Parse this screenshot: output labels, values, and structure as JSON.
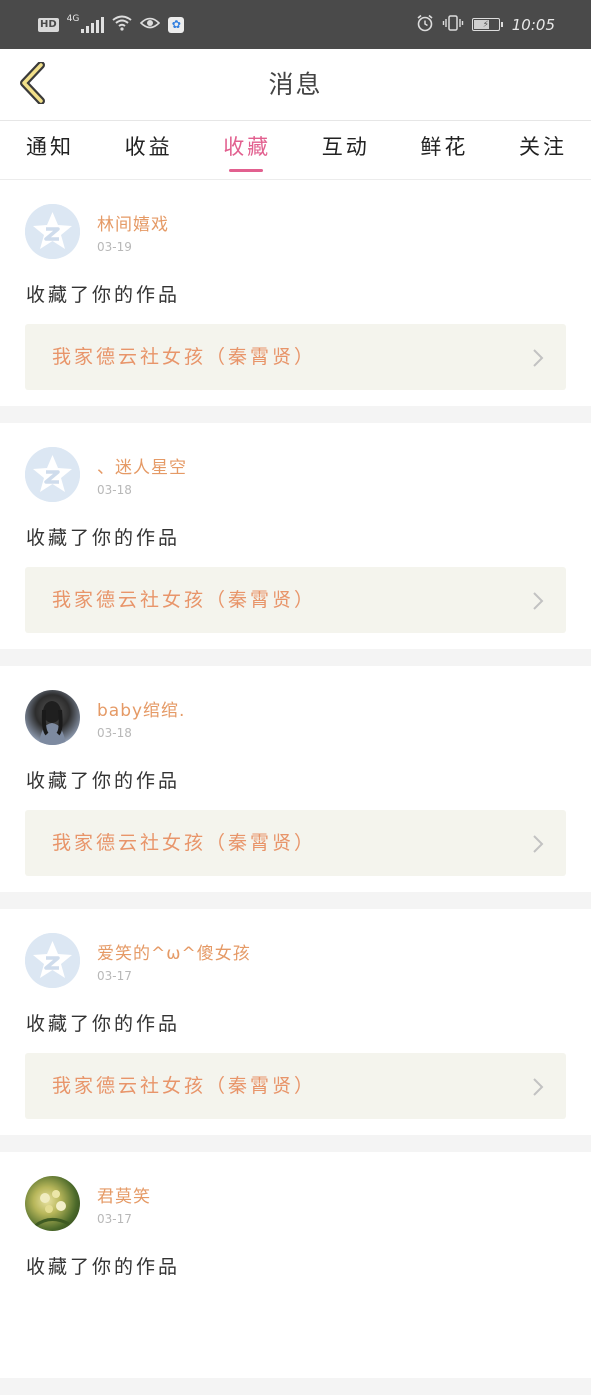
{
  "status_bar": {
    "hd": "HD",
    "network": "4G",
    "time": "10:05",
    "icons": [
      "signal-icon",
      "wifi-icon",
      "eye-icon",
      "paw-app-icon",
      "alarm-icon",
      "vibrate-icon",
      "battery-icon"
    ]
  },
  "header": {
    "title": "消息",
    "back_icon": "chevron-left-icon"
  },
  "tabs": [
    {
      "label": "通知",
      "active": false
    },
    {
      "label": "收益",
      "active": false
    },
    {
      "label": "收藏",
      "active": true
    },
    {
      "label": "互动",
      "active": false
    },
    {
      "label": "鲜花",
      "active": false
    },
    {
      "label": "关注",
      "active": false
    }
  ],
  "messages": [
    {
      "username": "林间嬉戏",
      "date": "03-19",
      "action": "收藏了你的作品",
      "work": "我家德云社女孩（秦霄贤）",
      "avatar": "default-avatar"
    },
    {
      "username": "、迷人星空",
      "date": "03-18",
      "action": "收藏了你的作品",
      "work": "我家德云社女孩（秦霄贤）",
      "avatar": "default-avatar"
    },
    {
      "username": "baby绾绾.",
      "date": "03-18",
      "action": "收藏了你的作品",
      "work": "我家德云社女孩（秦霄贤）",
      "avatar": "photo-avatar"
    },
    {
      "username": "爱笑的^ω^傻女孩",
      "date": "03-17",
      "action": "收藏了你的作品",
      "work": "我家德云社女孩（秦霄贤）",
      "avatar": "default-avatar"
    },
    {
      "username": "君莫笑",
      "date": "03-17",
      "action": "收藏了你的作品",
      "work": "",
      "avatar": "photo-avatar"
    }
  ],
  "colors": {
    "accent": "#e2608f",
    "username": "#e59a66",
    "work_title": "#e8956a",
    "status_bar": "#4a4a4a"
  }
}
